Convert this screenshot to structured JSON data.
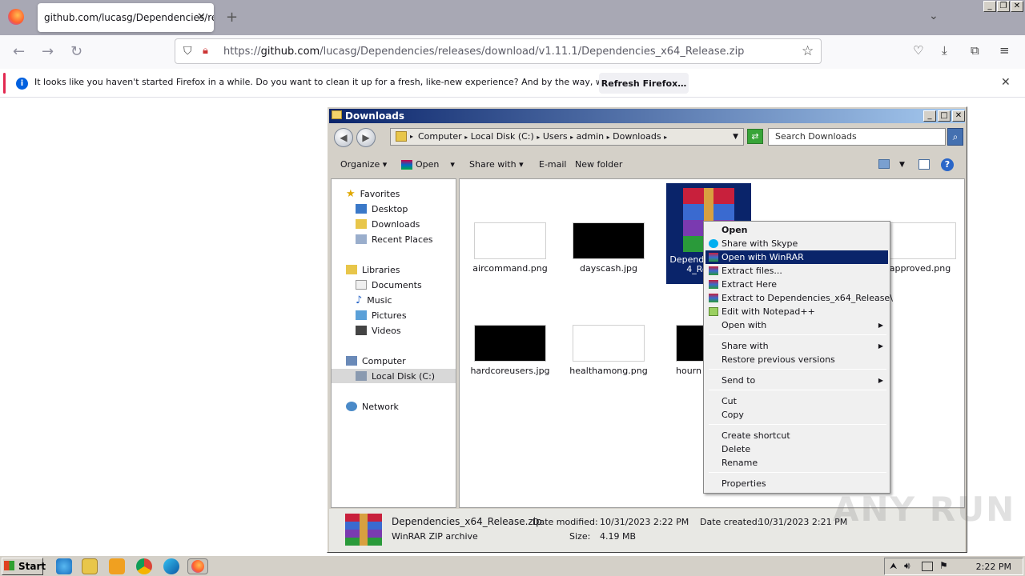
{
  "browser": {
    "tab_title": "github.com/lucasg/Dependencies/releases",
    "url_prefix": "https://",
    "url_domain": "github.com",
    "url_path": "/lucasg/Dependencies/releases/download/v1.11.1/Dependencies_x64_Release.zip",
    "notification": "It looks like you haven't started Firefox in a while. Do you want to clean it up for a fresh, like-new experience? And by the way, welcome back!",
    "refresh_label": "Refresh Firefox…"
  },
  "explorer": {
    "title": "Downloads",
    "breadcrumb": [
      "Computer",
      "Local Disk (C:)",
      "Users",
      "admin",
      "Downloads"
    ],
    "search_placeholder": "Search Downloads",
    "commands": {
      "organize": "Organize",
      "open": "Open",
      "share": "Share with",
      "email": "E-mail",
      "newfolder": "New folder"
    },
    "nav": {
      "favorites": "Favorites",
      "desktop": "Desktop",
      "downloads": "Downloads",
      "recent": "Recent Places",
      "libraries": "Libraries",
      "documents": "Documents",
      "music": "Music",
      "pictures": "Pictures",
      "videos": "Videos",
      "computer": "Computer",
      "localdisk": "Local Disk (C:)",
      "network": "Network"
    },
    "files": {
      "f1": "aircommand.png",
      "f2": "dayscash.jpg",
      "f3": "Dependencies_x64_Release",
      "f4": "approved.png",
      "f5": "hardcoreusers.jpg",
      "f6": "healthamong.png",
      "f7": "hourn"
    },
    "detail": {
      "name": "Dependencies_x64_Release.zip",
      "type": "WinRAR ZIP archive",
      "modified_label": "Date modified:",
      "modified": "10/31/2023 2:22 PM",
      "size_label": "Size:",
      "size": "4.19 MB",
      "created_label": "Date created:",
      "created": "10/31/2023 2:21 PM"
    }
  },
  "context_menu": {
    "open": "Open",
    "skype": "Share with Skype",
    "winrar": "Open with WinRAR",
    "extract_files": "Extract files...",
    "extract_here": "Extract Here",
    "extract_to": "Extract to Dependencies_x64_Release\\",
    "notepad": "Edit with Notepad++",
    "open_with": "Open with",
    "share_with": "Share with",
    "restore": "Restore previous versions",
    "send_to": "Send to",
    "cut": "Cut",
    "copy": "Copy",
    "shortcut": "Create shortcut",
    "delete": "Delete",
    "rename": "Rename",
    "properties": "Properties"
  },
  "taskbar": {
    "start": "Start",
    "clock": "2:22 PM"
  },
  "watermark": "ANY RUN"
}
